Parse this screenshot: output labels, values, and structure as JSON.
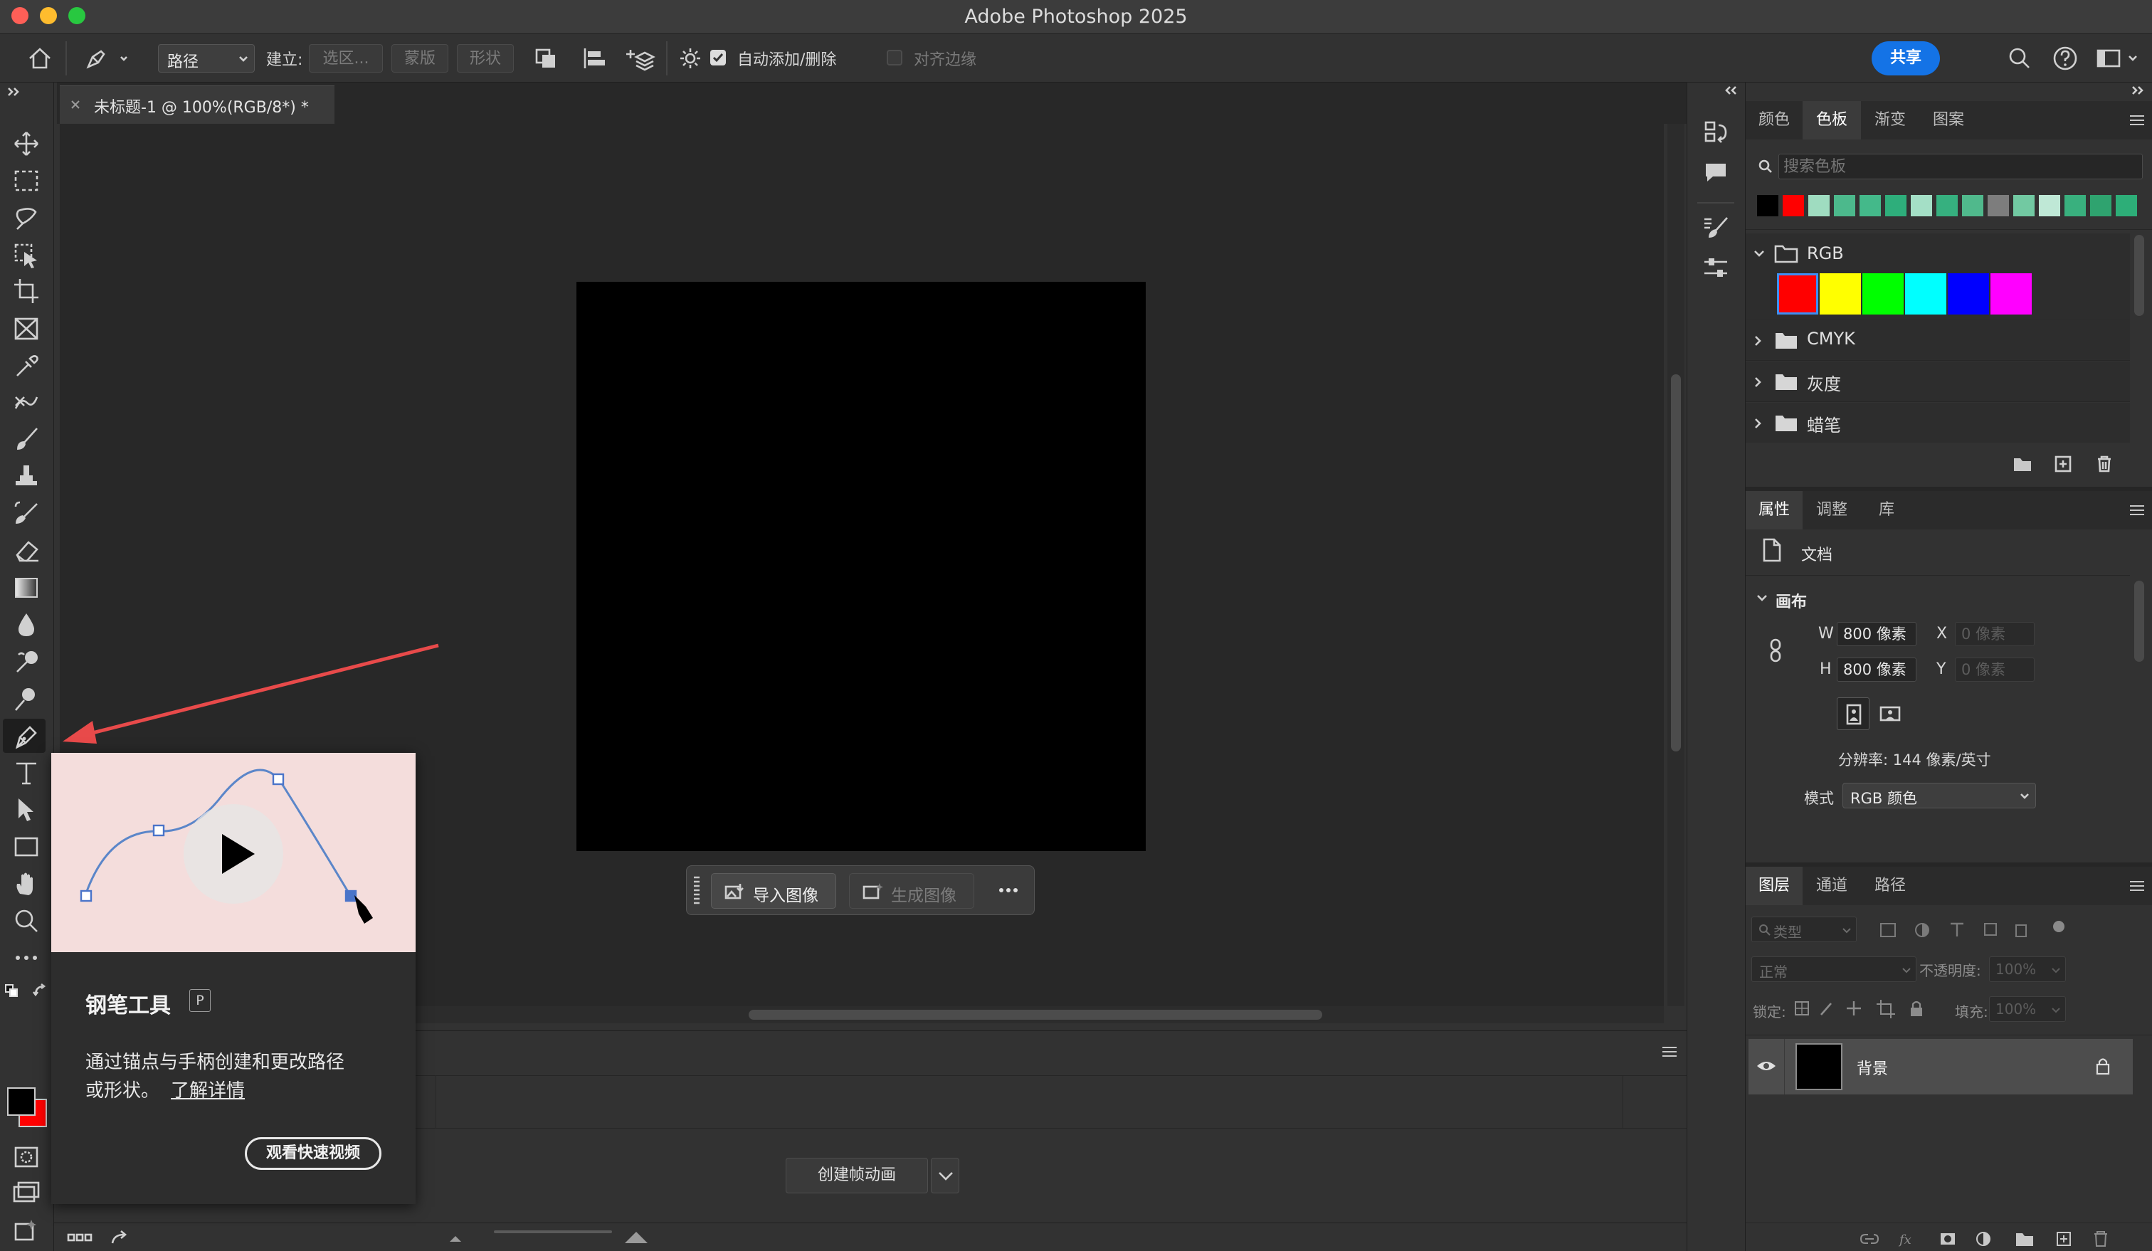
{
  "window": {
    "title": "Adobe Photoshop 2025"
  },
  "options_bar": {
    "mode_value": "路径",
    "make_label": "建立:",
    "selection_button": "选区...",
    "mask_button": "蒙版",
    "shape_button": "形状",
    "auto_add_delete_label": "自动添加/删除",
    "align_edges_label": "对齐边缘",
    "share_button": "共享"
  },
  "document": {
    "tab_title": "未标题-1 @ 100%(RGB/8*) *"
  },
  "contextual_bar": {
    "import_image": "导入图像",
    "generate_image": "生成图像"
  },
  "timeline": {
    "create_frame_animation": "创建帧动画"
  },
  "tooltip": {
    "tool_name": "钢笔工具",
    "shortcut": "P",
    "description": "通过锚点与手柄创建和更改路径",
    "description_line2": "或形状。",
    "learn_more": "了解详情",
    "watch_video": "观看快速视频"
  },
  "swatches_panel": {
    "tabs": [
      "颜色",
      "色板",
      "渐变",
      "图案"
    ],
    "search_placeholder": "搜索色板",
    "recent_colors": [
      "#000000",
      "#ff0000",
      "#9fdcc0",
      "#4cb98c",
      "#44b98a",
      "#2eae7b",
      "#a4dfc6",
      "#36b07f",
      "#50b98c",
      "#7d7d7d",
      "#72c9a2",
      "#bfe8d6",
      "#39b07e",
      "#2fa36f",
      "#2dae78"
    ],
    "groups": [
      {
        "name": "RGB",
        "expanded": true,
        "colors": [
          "#ff0000",
          "#ffff00",
          "#00ff00",
          "#00ffff",
          "#0000ff",
          "#ff00ff"
        ]
      },
      {
        "name": "CMYK",
        "expanded": false
      },
      {
        "name": "灰度",
        "expanded": false
      },
      {
        "name": "蜡笔",
        "expanded": false
      }
    ]
  },
  "properties_panel": {
    "tabs": [
      "属性",
      "调整",
      "库"
    ],
    "doc_label": "文档",
    "canvas_section": "画布",
    "w_label": "W",
    "w_value": "800 像素",
    "h_label": "H",
    "h_value": "800 像素",
    "x_label": "X",
    "x_placeholder": "0 像素",
    "y_label": "Y",
    "y_placeholder": "0 像素",
    "resolution": "分辨率: 144 像素/英寸",
    "mode_label": "模式",
    "mode_value": "RGB 颜色"
  },
  "layers_panel": {
    "tabs": [
      "图层",
      "通道",
      "路径"
    ],
    "filter_placeholder": "类型",
    "blend_mode": "正常",
    "opacity_label": "不透明度:",
    "opacity_value": "100%",
    "lock_label": "锁定:",
    "fill_label": "填充:",
    "fill_value": "100%",
    "layers": [
      {
        "name": "背景",
        "locked": true,
        "visible": true
      }
    ]
  },
  "colors": {
    "accent": "#1473e6",
    "arrow": "#e84a4a",
    "fg": "#000000",
    "bg": "#ff0000"
  }
}
